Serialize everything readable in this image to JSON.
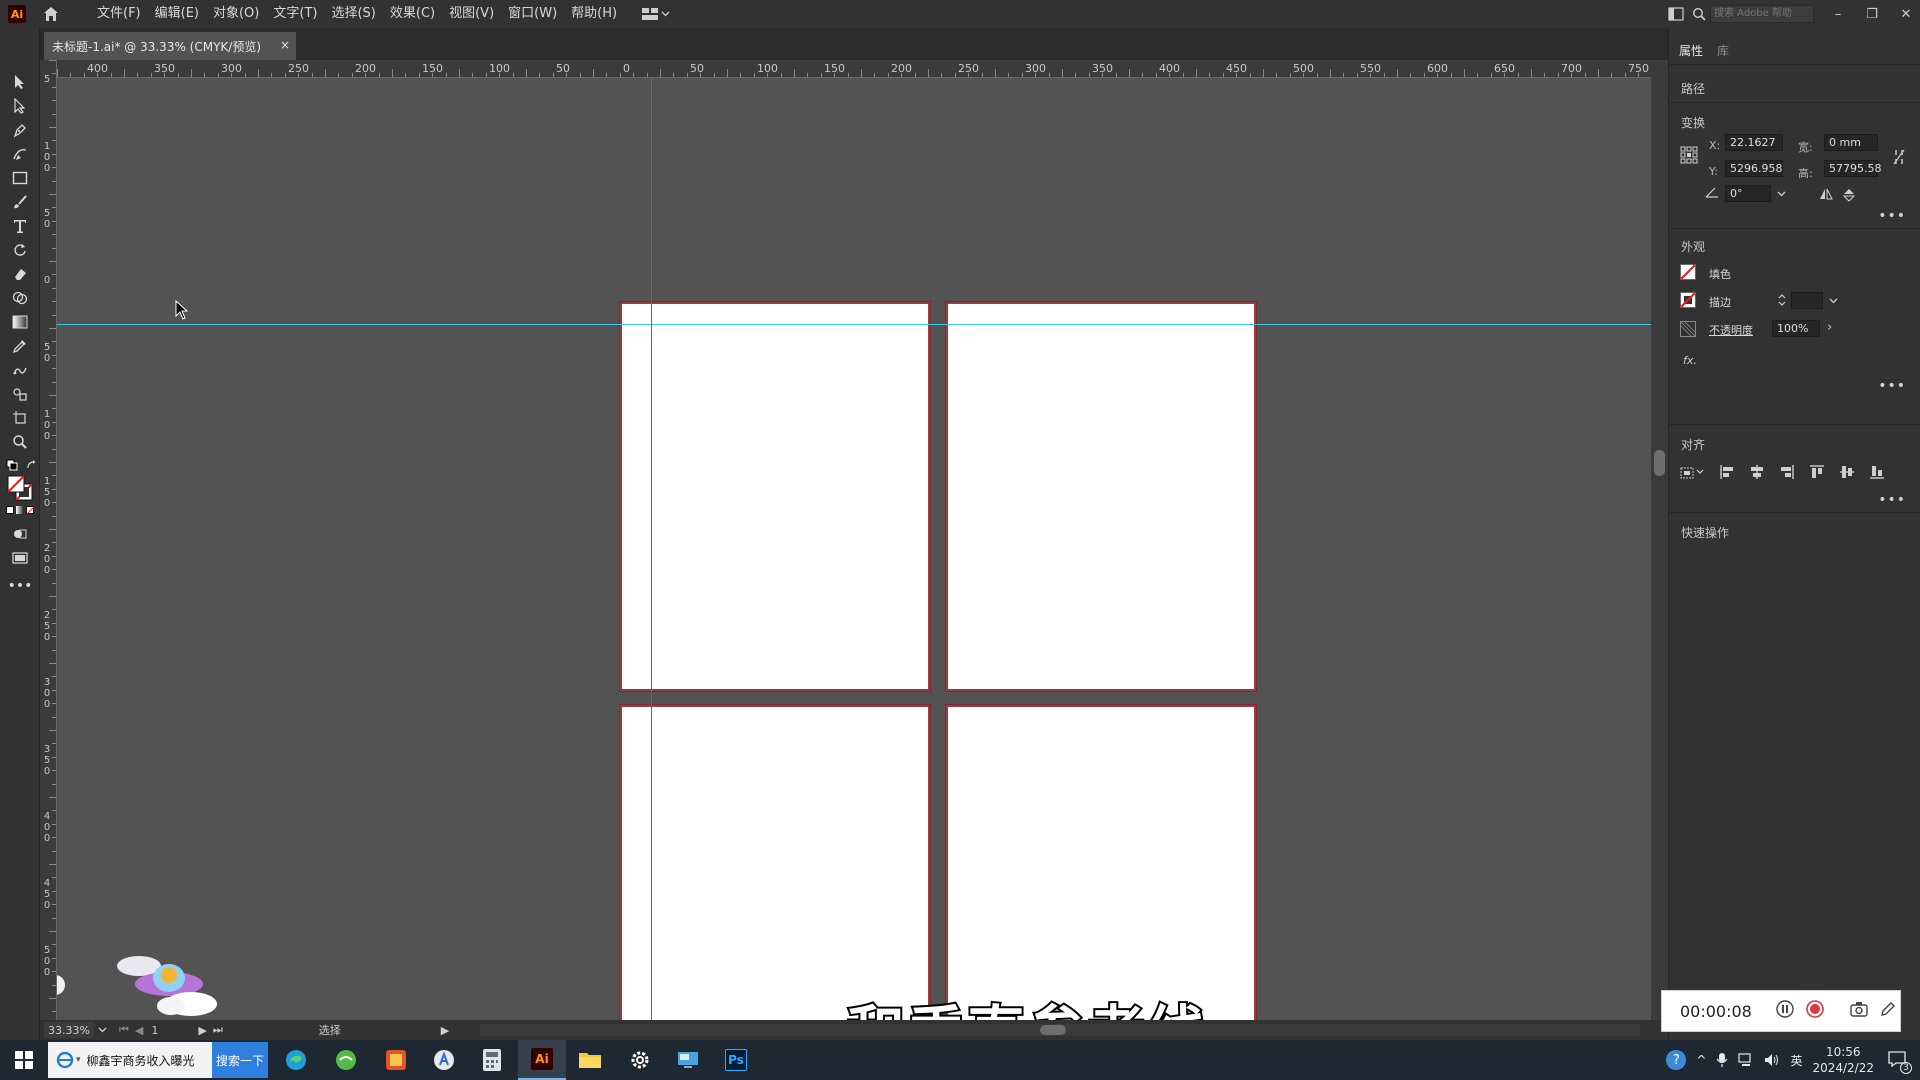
{
  "menubar": {
    "app_logo": "Ai",
    "items": [
      "文件(F)",
      "编辑(E)",
      "对象(O)",
      "文字(T)",
      "选择(S)",
      "效果(C)",
      "视图(V)",
      "窗口(W)",
      "帮助(H)"
    ],
    "search_placeholder": "搜索 Adobe 帮助"
  },
  "document_tab": {
    "title": "未标题-1.ai* @ 33.33% (CMYK/预览)",
    "close": "×"
  },
  "rulers": {
    "horizontal": [
      "400",
      "350",
      "300",
      "250",
      "200",
      "150",
      "100",
      "50",
      "0",
      "50",
      "100",
      "150",
      "200",
      "250",
      "300",
      "350",
      "400",
      "450",
      "500",
      "550",
      "600",
      "650",
      "700",
      "750"
    ],
    "vertical": [
      "5",
      "1 0 0",
      "5 0",
      "0",
      "5 0",
      "1 0 0",
      "1 5 0",
      "2 0 0",
      "2 5 0",
      "3 0 0",
      "3 5 0",
      "4 0 0",
      "4 5 0",
      "5 0 0"
    ]
  },
  "canvas": {
    "subtitle": "和垂直参考线"
  },
  "statusbar": {
    "zoom": "33.33%",
    "artboard_num": "1",
    "mode": "选择"
  },
  "panel": {
    "tabs": [
      "属性",
      "库"
    ],
    "object_type": "路径",
    "transform": {
      "title": "变换",
      "x_label": "X:",
      "x_value": "22.1627",
      "y_label": "Y:",
      "y_value": "5296.958",
      "w_label": "宽:",
      "w_value": "0 mm",
      "h_label": "高:",
      "h_value": "57795.58",
      "angle_value": "0°"
    },
    "appearance": {
      "title": "外观",
      "fill_label": "填色",
      "stroke_label": "描边",
      "opacity_label": "不透明度",
      "opacity_value": "100%",
      "fx_label": "fx."
    },
    "align": {
      "title": "对齐"
    },
    "quick_actions": {
      "title": "快速操作"
    },
    "more": "•••"
  },
  "recorder": {
    "time": "00:00:08"
  },
  "taskbar": {
    "search_text": "柳鑫宇商务收入曝光",
    "search_button": "搜索一下",
    "ime": "英",
    "time": "10:56",
    "date": "2024/2/22",
    "notification_count": "3"
  },
  "colors": {
    "accent_blue": "#2f7fe0",
    "guide_cyan": "#41c8e0",
    "guide_violet": "#5a5ae6",
    "artboard_border": "#9a3a45"
  }
}
